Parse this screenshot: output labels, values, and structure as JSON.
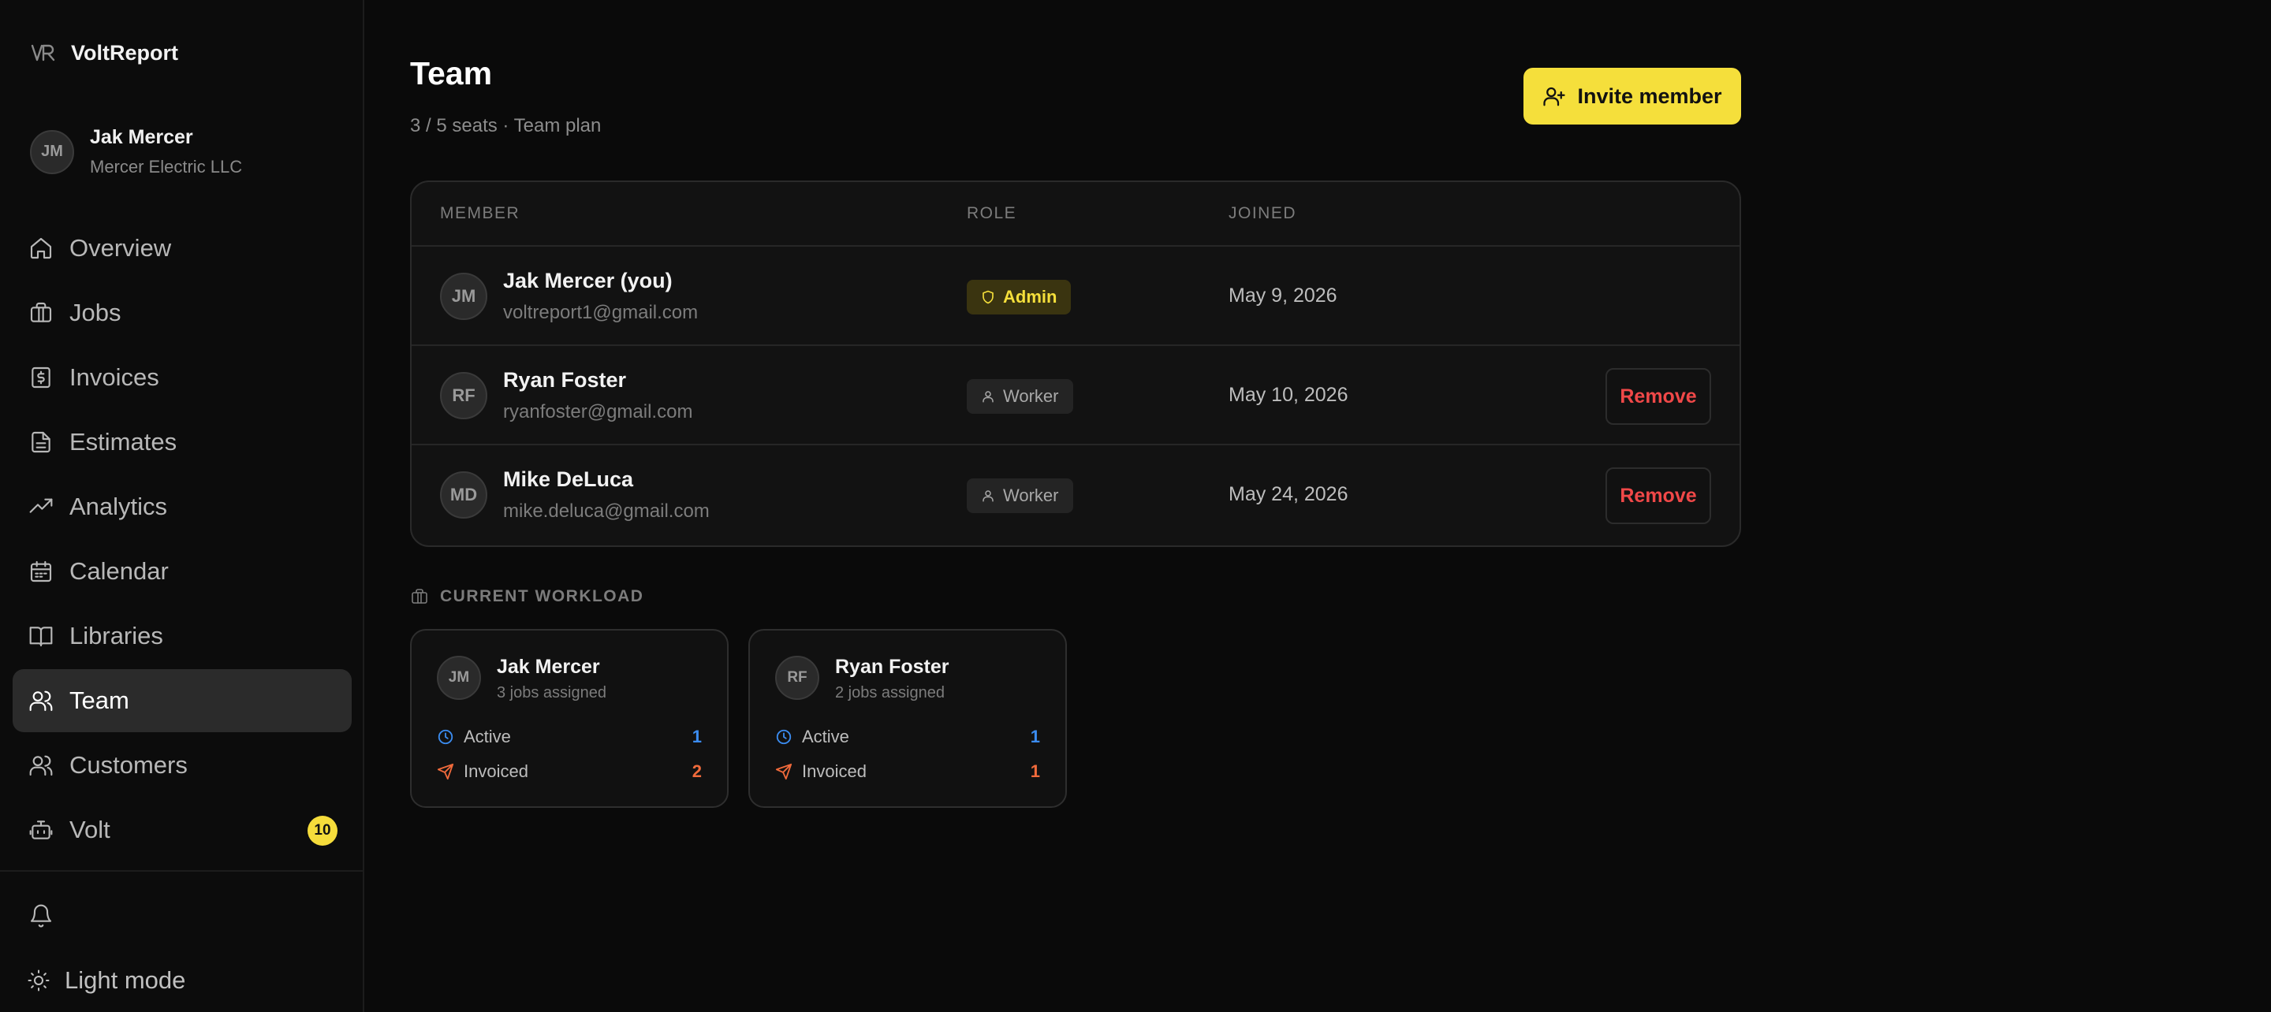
{
  "app": {
    "name": "VoltReport"
  },
  "user": {
    "initials": "JM",
    "name": "Jak Mercer",
    "company": "Mercer Electric LLC"
  },
  "nav": [
    {
      "label": "Overview",
      "icon": "home-icon"
    },
    {
      "label": "Jobs",
      "icon": "briefcase-icon"
    },
    {
      "label": "Invoices",
      "icon": "invoice-dollar-icon"
    },
    {
      "label": "Estimates",
      "icon": "document-icon"
    },
    {
      "label": "Analytics",
      "icon": "trending-up-icon"
    },
    {
      "label": "Calendar",
      "icon": "calendar-icon"
    },
    {
      "label": "Libraries",
      "icon": "book-icon"
    },
    {
      "label": "Team",
      "icon": "users-icon",
      "active": true
    },
    {
      "label": "Customers",
      "icon": "users-icon"
    },
    {
      "label": "Volt",
      "icon": "bot-icon",
      "badge": "10"
    }
  ],
  "footer": {
    "light_mode": "Light mode"
  },
  "page": {
    "title": "Team",
    "seats": "3 / 5 seats · Team plan",
    "invite_label": "Invite member"
  },
  "table": {
    "headers": {
      "member": "MEMBER",
      "role": "ROLE",
      "joined": "JOINED"
    },
    "rows": [
      {
        "initials": "JM",
        "name": "Jak Mercer (you)",
        "email": "voltreport1@gmail.com",
        "role": "Admin",
        "joined": "May 9, 2026"
      },
      {
        "initials": "RF",
        "name": "Ryan Foster",
        "email": "ryanfoster@gmail.com",
        "role": "Worker",
        "joined": "May 10, 2026",
        "action": "Remove"
      },
      {
        "initials": "MD",
        "name": "Mike DeLuca",
        "email": "mike.deluca@gmail.com",
        "role": "Worker",
        "joined": "May 24, 2026",
        "action": "Remove"
      }
    ]
  },
  "workload": {
    "label": "CURRENT WORKLOAD",
    "cards": [
      {
        "initials": "JM",
        "name": "Jak Mercer",
        "sub": "3 jobs assigned",
        "active_label": "Active",
        "active": "1",
        "invoiced_label": "Invoiced",
        "invoiced": "2"
      },
      {
        "initials": "RF",
        "name": "Ryan Foster",
        "sub": "2 jobs assigned",
        "active_label": "Active",
        "active": "1",
        "invoiced_label": "Invoiced",
        "invoiced": "1"
      }
    ]
  },
  "colors": {
    "accent": "#f5df3b",
    "danger": "#f04848",
    "active_blue": "#3b8cf0",
    "invoiced_orange": "#f06a3b"
  }
}
